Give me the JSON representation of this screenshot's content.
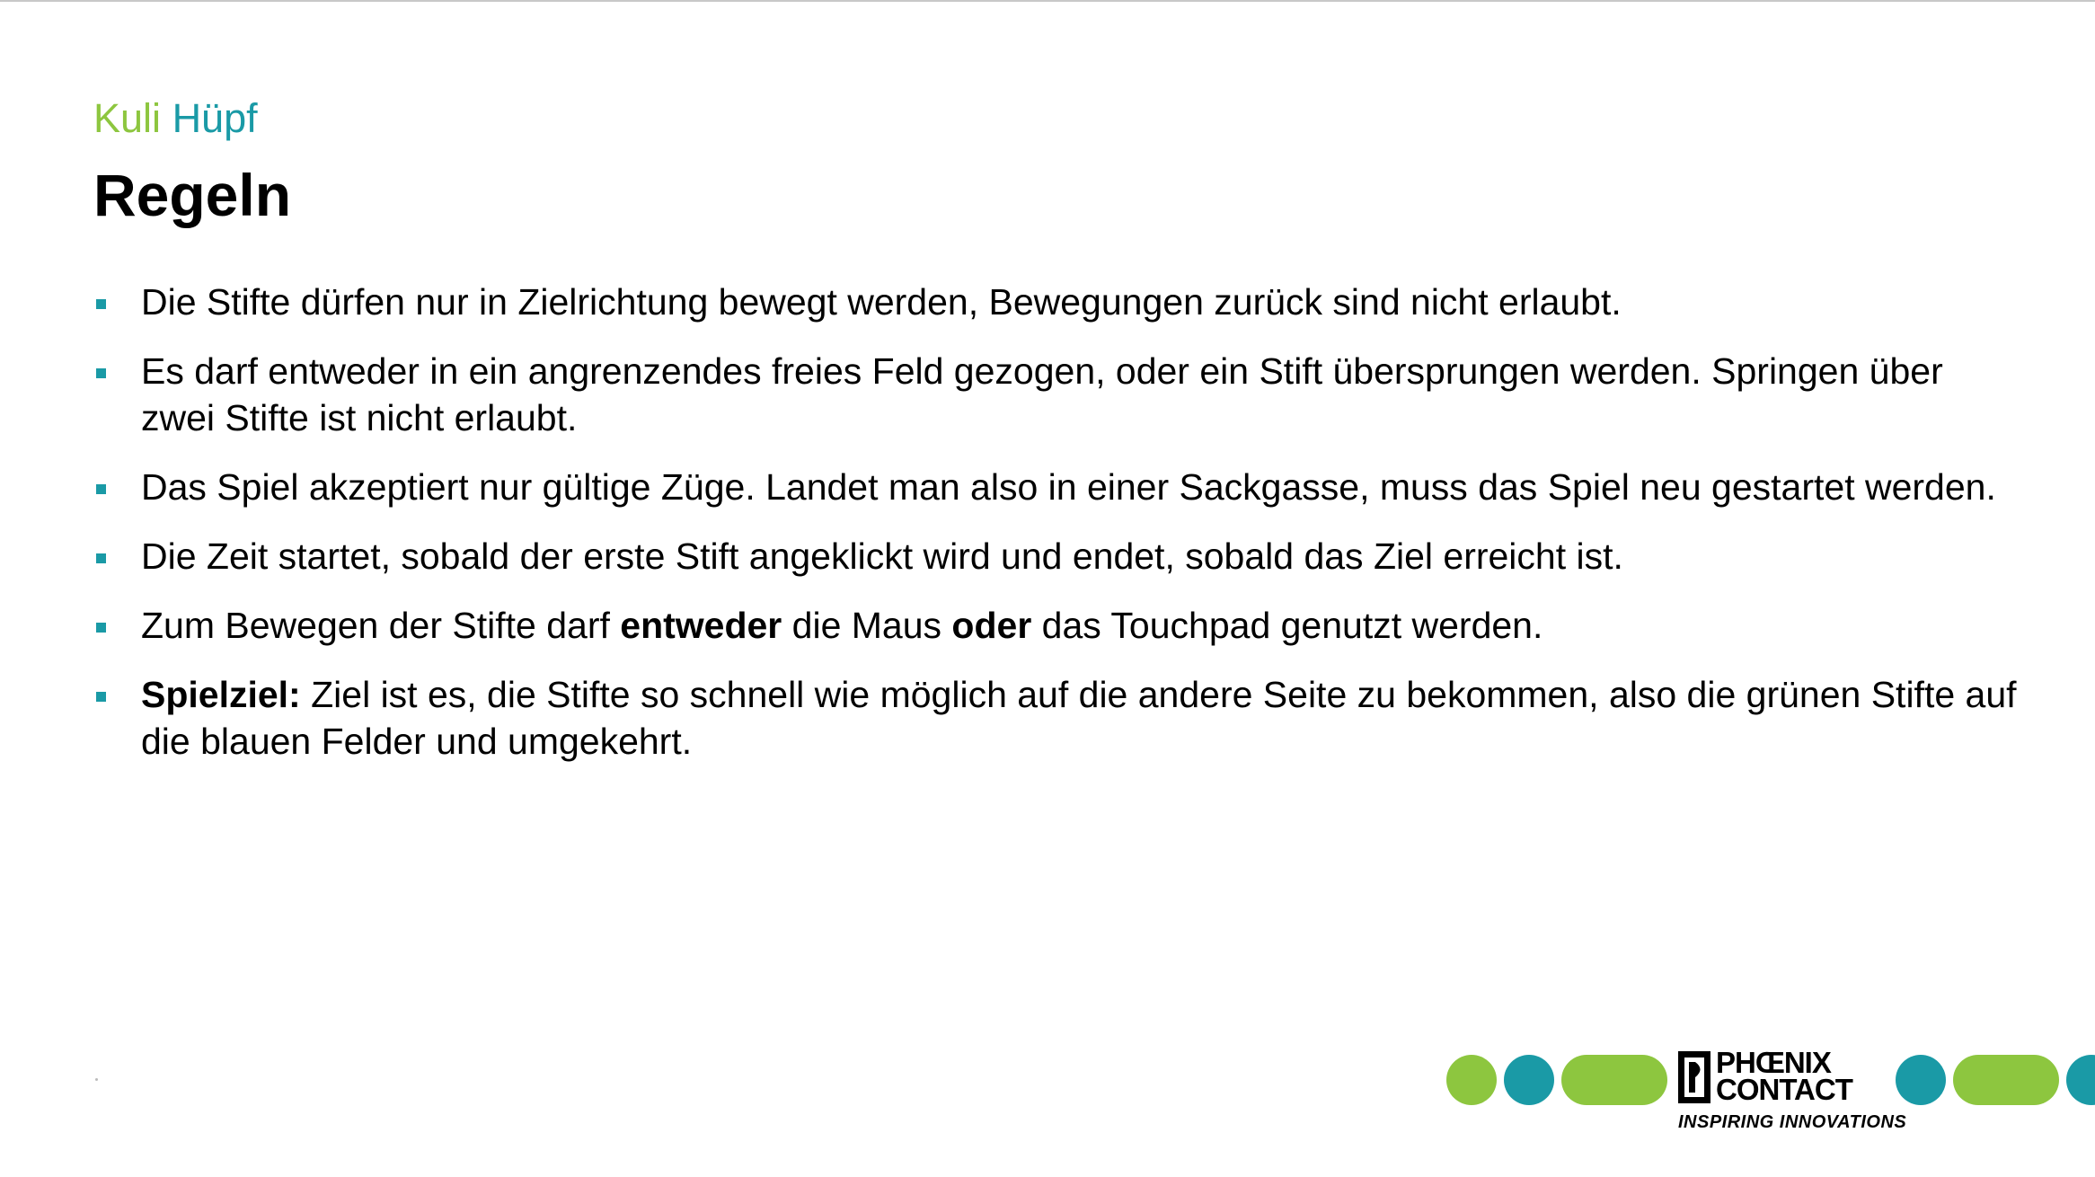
{
  "header": {
    "kicker_word1": "Kuli",
    "kicker_word2": "Hüpf",
    "title": "Regeln"
  },
  "rules": [
    {
      "parts": [
        {
          "text": "Die Stifte dürfen nur in Zielrichtung bewegt werden, Bewegungen zurück sind nicht erlaubt.",
          "bold": false
        }
      ]
    },
    {
      "parts": [
        {
          "text": "Es darf entweder in ein angrenzendes freies Feld gezogen, oder ein Stift übersprungen werden. Springen über zwei Stifte ist nicht erlaubt.",
          "bold": false
        }
      ]
    },
    {
      "parts": [
        {
          "text": "Das Spiel akzeptiert nur gültige Züge. Landet man also in einer Sackgasse, muss das Spiel neu gestartet werden.",
          "bold": false
        }
      ]
    },
    {
      "parts": [
        {
          "text": "Die Zeit startet, sobald der erste Stift angeklickt wird und endet, sobald das Ziel erreicht ist.",
          "bold": false
        }
      ]
    },
    {
      "parts": [
        {
          "text": "Zum Bewegen der Stifte darf ",
          "bold": false
        },
        {
          "text": "entweder",
          "bold": true
        },
        {
          "text": " die Maus ",
          "bold": false
        },
        {
          "text": "oder",
          "bold": true
        },
        {
          "text": " das Touchpad genutzt werden.",
          "bold": false
        }
      ]
    },
    {
      "parts": [
        {
          "text": "Spielziel:",
          "bold": true
        },
        {
          "text": " Ziel ist es, die Stifte so schnell wie möglich auf die andere Seite zu bekommen, also die grünen Stifte auf die blauen Felder und umgekehrt.",
          "bold": false
        }
      ]
    }
  ],
  "logo": {
    "brand_line1": "PHŒNIX",
    "brand_line2": "CONTACT",
    "tagline": "INSPIRING INNOVATIONS",
    "icon": "phoenix-contact-logo-icon"
  },
  "colors": {
    "accent_green": "#8dc63f",
    "accent_teal": "#1a9aa6",
    "text": "#000000"
  }
}
